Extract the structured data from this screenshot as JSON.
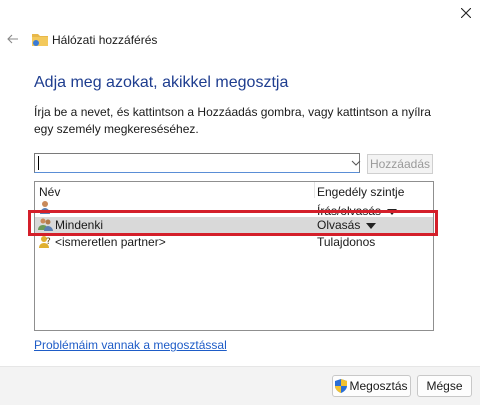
{
  "window": {
    "title": "Hálózati hozzáférés"
  },
  "header": {
    "heading": "Adja meg azokat, akikkel megosztja"
  },
  "instructions": "Írja be a nevet, és kattintson a Hozzáadás gombra, vagy kattintson a nyílra egy személy megkereséséhez.",
  "input": {
    "value": "",
    "placeholder": ""
  },
  "add_button": {
    "label": "Hozzáadás",
    "enabled": false
  },
  "table": {
    "columns": [
      "Név",
      "Engedély szintje"
    ],
    "rows": [
      {
        "name": "",
        "permission": "Írás/olvasás",
        "icon": "user-icon"
      },
      {
        "name": "Mindenki",
        "permission": "Olvasás",
        "icon": "group-icon",
        "selected": true
      },
      {
        "name": "<ismeretlen partner>",
        "permission": "Tulajdonos",
        "icon": "unknown-user-icon"
      }
    ]
  },
  "link": "Problémáim vannak a megosztással",
  "footer": {
    "share_label": "Megosztás",
    "cancel_label": "Mégse"
  },
  "colors": {
    "heading": "#1e3d8f",
    "link": "#1e5cc7",
    "highlight": "#d41f2a"
  }
}
